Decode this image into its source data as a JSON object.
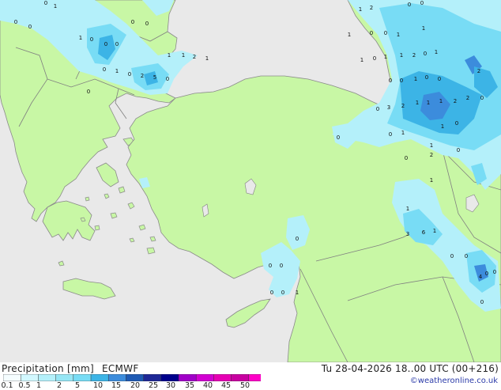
{
  "map": {
    "cell_labels": [
      "0",
      "1",
      "0",
      "0",
      "0",
      "0",
      "0",
      "1",
      "0",
      "0",
      "0",
      "1",
      "0",
      "1",
      "1",
      "2",
      "1",
      "2",
      "5",
      "0",
      "0",
      "1",
      "2",
      "1",
      "0",
      "0",
      "1",
      "0",
      "0",
      "1",
      "1",
      "0",
      "1",
      "1",
      "2",
      "0",
      "1",
      "0",
      "0",
      "1",
      "0",
      "0",
      "2",
      "0",
      "3",
      "2",
      "1",
      "1",
      "1",
      "2",
      "2",
      "0",
      "0",
      "1",
      "1",
      "0",
      "1",
      "0",
      "2",
      "0",
      "1",
      "0",
      "1",
      "3",
      "6",
      "1",
      "0",
      "0",
      "0",
      "0",
      "0",
      "0",
      "1",
      "0",
      "0",
      "0",
      "4",
      "0"
    ],
    "colors": {
      "sea": "#e9e9e9",
      "land": "#c8f7a5",
      "border": "#808080",
      "precip_light": "#b4f0fa",
      "precip_med": "#78dcf5",
      "precip_heavy": "#3cb4e6",
      "precip_vheavy": "#3c8cdc"
    }
  },
  "legend": {
    "title": "Precipitation [mm]",
    "model": "ECMWF",
    "tick_labels": [
      "0.1",
      "0.5",
      "1",
      "2",
      "5",
      "10",
      "15",
      "20",
      "25",
      "30",
      "35",
      "40",
      "45",
      "50"
    ],
    "colors": [
      "#f5fdff",
      "#d2f8ff",
      "#b4f0fa",
      "#96e6f5",
      "#78dcf5",
      "#3cb4e6",
      "#3c8cdc",
      "#1e5ab4",
      "#1e2896",
      "#00008c",
      "#a000c8",
      "#d200d2",
      "#e600b4",
      "#c800a0",
      "#ff00c8"
    ]
  },
  "run_time": "Tu 28-04-2026 18..00 UTC (00+216)",
  "copyright": "©weatheronline.co.uk"
}
